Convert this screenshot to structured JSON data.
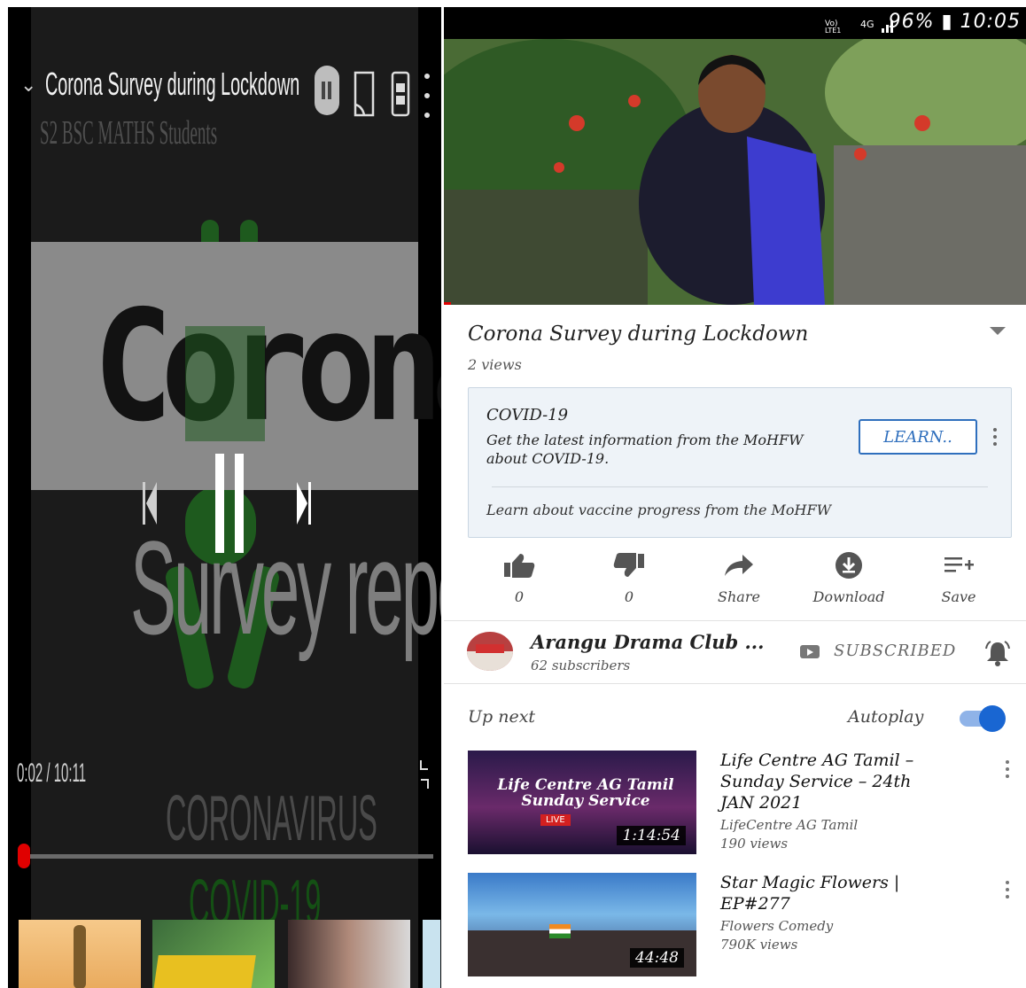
{
  "left_player": {
    "title": "Corona Survey during Lockdown",
    "channel_overlay": "S2 BSC MATHS Students",
    "slide_title": "Corona",
    "slide_subtitle": "Survey report",
    "slide_footer_1": "CORONAVIRUS",
    "slide_footer_2": "COVID-19",
    "time": "0:02 / 10:11",
    "progress_fraction": 0.003
  },
  "status_bar": {
    "text": "96% ▮ 10:05"
  },
  "video": {
    "title": "Corona Survey during Lockdown",
    "views": "2 views"
  },
  "info_card": {
    "heading": "COVID-19",
    "description": "Get the latest information from the MoHFW about COVID-19.",
    "button_label": "LEARN..",
    "vaccine_text": "Learn about vaccine progress from the MoHFW"
  },
  "actions": {
    "like": "0",
    "dislike": "0",
    "share": "Share",
    "download": "Download",
    "save": "Save"
  },
  "channel": {
    "name": "Arangu Drama Club ...",
    "subscribers": "62 subscribers",
    "subscribe_status": "SUBSCRIBED"
  },
  "up_next": {
    "label": "Up next",
    "autoplay_label": "Autoplay",
    "autoplay_on": true,
    "items": [
      {
        "title": "Life Centre AG Tamil – Sunday Service – 24th JAN 2021",
        "channel": "LifeCentre AG Tamil",
        "views": "190 views",
        "duration": "1:14:54",
        "thumb_text": "Life Centre AG Tamil Sunday Service",
        "live_badge": "LIVE"
      },
      {
        "title": "Star Magic Flowers | EP#277",
        "channel": "Flowers Comedy",
        "views": "790K views",
        "duration": "44:48"
      }
    ]
  }
}
